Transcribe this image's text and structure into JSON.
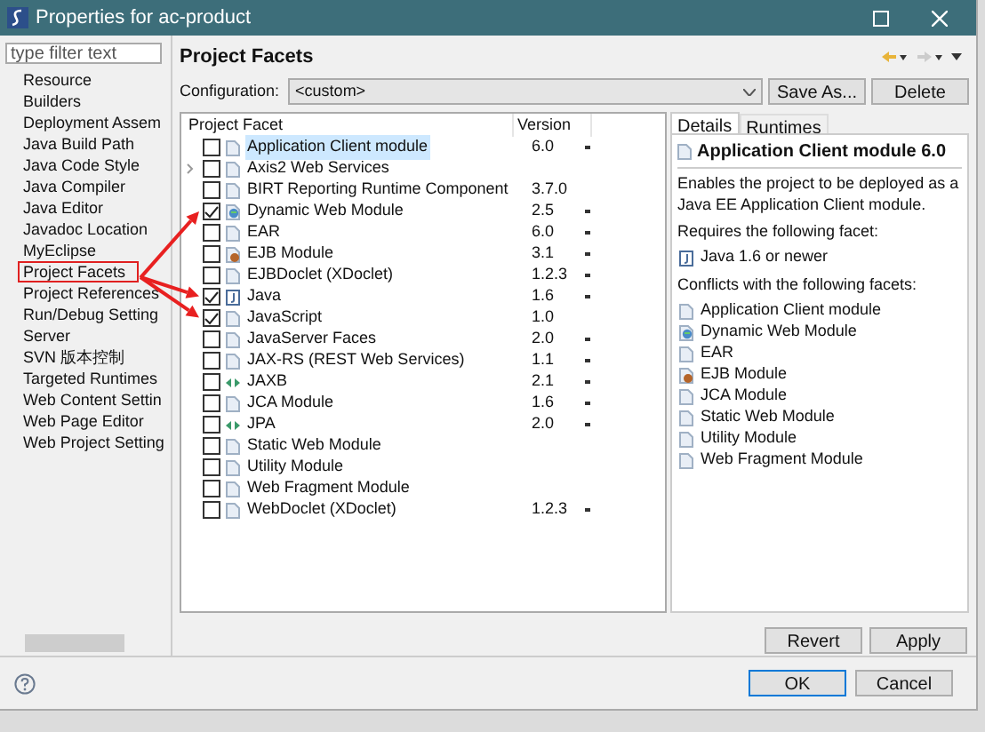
{
  "window": {
    "title": "Properties for ac-product"
  },
  "filter": {
    "placeholder": "type filter text"
  },
  "sidebar": {
    "items": [
      {
        "label": "Resource",
        "selected": false
      },
      {
        "label": "Builders",
        "selected": false
      },
      {
        "label": "Deployment Assem",
        "selected": false
      },
      {
        "label": "Java Build Path",
        "selected": false
      },
      {
        "label": "Java Code Style",
        "selected": false
      },
      {
        "label": "Java Compiler",
        "selected": false
      },
      {
        "label": "Java Editor",
        "selected": false
      },
      {
        "label": "Javadoc Location",
        "selected": false
      },
      {
        "label": "MyEclipse",
        "selected": false
      },
      {
        "label": "Project Facets",
        "selected": true
      },
      {
        "label": "Project References",
        "selected": false
      },
      {
        "label": "Run/Debug Setting",
        "selected": false
      },
      {
        "label": "Server",
        "selected": false
      },
      {
        "label": "SVN 版本控制",
        "selected": false
      },
      {
        "label": "Targeted Runtimes",
        "selected": false
      },
      {
        "label": "Web Content Settin",
        "selected": false
      },
      {
        "label": "Web Page Editor",
        "selected": false
      },
      {
        "label": "Web Project Setting",
        "selected": false
      }
    ]
  },
  "page": {
    "title": "Project Facets"
  },
  "configuration": {
    "label": "Configuration:",
    "value": "<custom>",
    "buttons": [
      "Save As...",
      "Delete"
    ]
  },
  "table": {
    "columns": [
      "Project Facet",
      "Version"
    ],
    "rows": [
      {
        "name": "Application Client module",
        "version": "6.0",
        "kind": "doc",
        "checked": false,
        "selected": true,
        "expandable": false,
        "dropdown": true,
        "marked": false
      },
      {
        "name": "Axis2 Web Services",
        "version": "",
        "kind": "doc",
        "checked": false,
        "selected": false,
        "expandable": true,
        "dropdown": false,
        "marked": false
      },
      {
        "name": "BIRT Reporting Runtime Component",
        "version": "3.7.0",
        "kind": "doc",
        "checked": false,
        "selected": false,
        "expandable": false,
        "dropdown": false,
        "marked": false
      },
      {
        "name": "Dynamic Web Module",
        "version": "2.5",
        "kind": "web",
        "checked": true,
        "selected": false,
        "expandable": false,
        "dropdown": true,
        "marked": true
      },
      {
        "name": "EAR",
        "version": "6.0",
        "kind": "doc",
        "checked": false,
        "selected": false,
        "expandable": false,
        "dropdown": true,
        "marked": false
      },
      {
        "name": "EJB Module",
        "version": "3.1",
        "kind": "ejb",
        "checked": false,
        "selected": false,
        "expandable": false,
        "dropdown": true,
        "marked": false
      },
      {
        "name": "EJBDoclet (XDoclet)",
        "version": "1.2.3",
        "kind": "doc",
        "checked": false,
        "selected": false,
        "expandable": false,
        "dropdown": true,
        "marked": false
      },
      {
        "name": "Java",
        "version": "1.6",
        "kind": "java",
        "checked": true,
        "selected": false,
        "expandable": false,
        "dropdown": true,
        "marked": true
      },
      {
        "name": "JavaScript",
        "version": "1.0",
        "kind": "doc",
        "checked": true,
        "selected": false,
        "expandable": false,
        "dropdown": false,
        "marked": true
      },
      {
        "name": "JavaServer Faces",
        "version": "2.0",
        "kind": "doc",
        "checked": false,
        "selected": false,
        "expandable": false,
        "dropdown": true,
        "marked": false
      },
      {
        "name": "JAX-RS (REST Web Services)",
        "version": "1.1",
        "kind": "doc",
        "checked": false,
        "selected": false,
        "expandable": false,
        "dropdown": true,
        "marked": false
      },
      {
        "name": "JAXB",
        "version": "2.1",
        "kind": "link",
        "checked": false,
        "selected": false,
        "expandable": false,
        "dropdown": true,
        "marked": false
      },
      {
        "name": "JCA Module",
        "version": "1.6",
        "kind": "doc",
        "checked": false,
        "selected": false,
        "expandable": false,
        "dropdown": true,
        "marked": false
      },
      {
        "name": "JPA",
        "version": "2.0",
        "kind": "link",
        "checked": false,
        "selected": false,
        "expandable": false,
        "dropdown": true,
        "marked": false
      },
      {
        "name": "Static Web Module",
        "version": "",
        "kind": "doc",
        "checked": false,
        "selected": false,
        "expandable": false,
        "dropdown": false,
        "marked": false
      },
      {
        "name": "Utility Module",
        "version": "",
        "kind": "doc",
        "checked": false,
        "selected": false,
        "expandable": false,
        "dropdown": false,
        "marked": false
      },
      {
        "name": "Web Fragment Module",
        "version": "",
        "kind": "doc",
        "checked": false,
        "selected": false,
        "expandable": false,
        "dropdown": false,
        "marked": false
      },
      {
        "name": "WebDoclet (XDoclet)",
        "version": "1.2.3",
        "kind": "doc",
        "checked": false,
        "selected": false,
        "expandable": false,
        "dropdown": true,
        "marked": false
      }
    ]
  },
  "details": {
    "tabs": [
      {
        "label": "Details",
        "selected": true
      },
      {
        "label": "Runtimes",
        "selected": false
      }
    ],
    "title": "Application Client module 6.0",
    "description": "Enables the project to be deployed as a Java EE Application Client module.",
    "requires_heading": "Requires the following facet:",
    "requires": [
      {
        "label": "Java 1.6 or newer",
        "kind": "java"
      }
    ],
    "conflicts_heading": "Conflicts with the following facets:",
    "conflicts": [
      {
        "label": "Application Client module",
        "kind": "doc"
      },
      {
        "label": "Dynamic Web Module",
        "kind": "web"
      },
      {
        "label": "EAR",
        "kind": "doc"
      },
      {
        "label": "EJB Module",
        "kind": "ejb"
      },
      {
        "label": "JCA Module",
        "kind": "doc"
      },
      {
        "label": "Static Web Module",
        "kind": "doc"
      },
      {
        "label": "Utility Module",
        "kind": "doc"
      },
      {
        "label": "Web Fragment Module",
        "kind": "doc"
      }
    ]
  },
  "page_buttons": [
    "Revert",
    "Apply"
  ],
  "dialog_buttons": [
    {
      "label": "OK",
      "default": true
    },
    {
      "label": "Cancel",
      "default": false
    }
  ]
}
